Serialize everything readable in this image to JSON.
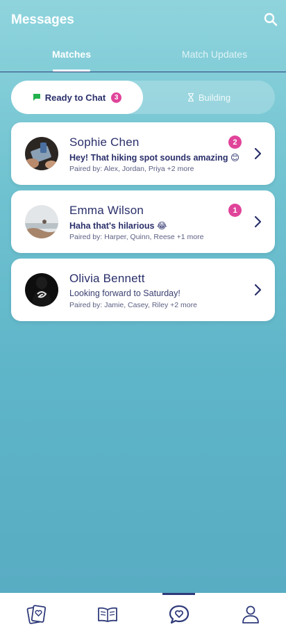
{
  "header": {
    "title": "Messages",
    "tabs": [
      {
        "label": "Matches",
        "active": true
      },
      {
        "label": "Match Updates",
        "active": false
      }
    ]
  },
  "segment": {
    "ready": {
      "label": "Ready to Chat",
      "count": "3",
      "icon": "chat-bubble-icon"
    },
    "building": {
      "label": "Building",
      "icon": "hourglass-icon"
    }
  },
  "chats": [
    {
      "name": "Sophie Chen",
      "message": "Hey! That hiking spot sounds amazing 😊",
      "paired_by": "Paired by: Alex, Jordan, Priya +2 more",
      "unread": "2"
    },
    {
      "name": "Emma Wilson",
      "message": "Haha that's hilarious 😂",
      "paired_by": "Paired by: Harper, Quinn, Reese +1 more",
      "unread": "1"
    },
    {
      "name": "Olivia Bennett",
      "message": "Looking forward to Saturday!",
      "paired_by": "Paired by: Jamie, Casey, Riley +2 more",
      "unread": ""
    }
  ],
  "bottom_nav": [
    {
      "icon": "cards-heart-icon",
      "active": false
    },
    {
      "icon": "open-book-icon",
      "active": false
    },
    {
      "icon": "chat-heart-icon",
      "active": true
    },
    {
      "icon": "profile-icon",
      "active": false
    }
  ],
  "colors": {
    "accent": "#2a2f6a",
    "badge": "#e0449a",
    "ready_icon": "#22b14c"
  }
}
